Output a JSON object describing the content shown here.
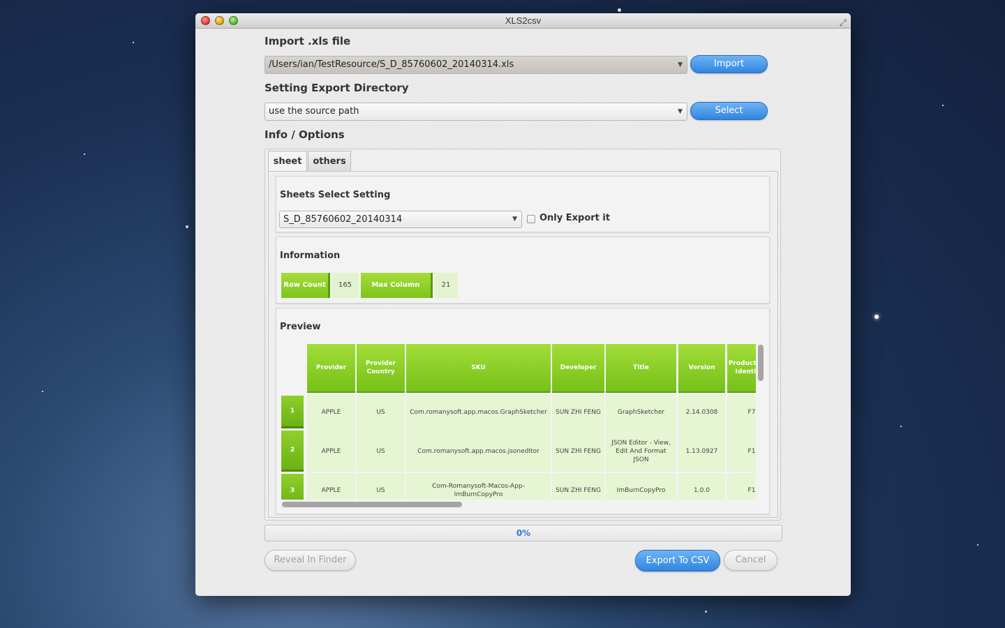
{
  "window": {
    "title": "XLS2csv"
  },
  "import_section": {
    "label": "Import .xls file",
    "file_path": "/Users/ian/TestResource/S_D_85760602_20140314.xls",
    "import_button": "Import"
  },
  "export_section": {
    "label": "Setting Export Directory",
    "directory": "use the source path",
    "select_button": "Select"
  },
  "info_section": {
    "label": "Info / Options",
    "tabs": [
      {
        "label": "sheet"
      },
      {
        "label": "others"
      }
    ]
  },
  "sheets_panel": {
    "title": "Sheets Select Setting",
    "selected_sheet": "S_D_85760602_20140314",
    "only_export_label": "Only Export it"
  },
  "information_panel": {
    "title": "Information",
    "row_count_label": "Row Count",
    "row_count_value": "165",
    "max_col_label": "Max Column Count",
    "max_col_value": "21"
  },
  "preview_panel": {
    "title": "Preview",
    "headers": [
      "Provider",
      "Provider Country",
      "SKU",
      "Developer",
      "Title",
      "Version",
      "Product Type Identifier"
    ],
    "rows": [
      {
        "num": "1",
        "cells": [
          "APPLE",
          "US",
          "Com.romanysoft.app.macos.GraphSketcher",
          "SUN ZHI FENG",
          "GraphSketcher",
          "2.14.0308",
          "F7"
        ]
      },
      {
        "num": "2",
        "cells": [
          "APPLE",
          "US",
          "Com.romanysoft.app.macos.jsonedItor",
          "SUN ZHI FENG",
          "JSON Editor - View, Edit And Format JSON",
          "1.13.0927",
          "F1"
        ]
      },
      {
        "num": "3",
        "cells": [
          "APPLE",
          "US",
          "Com-Romanysoft-Macos-App-ImBurnCopyPro",
          "SUN ZHI FENG",
          "ImBurnCopyPro",
          "1.0.0",
          "F1"
        ]
      }
    ]
  },
  "progress": {
    "text": "0%"
  },
  "footer": {
    "reveal_button": "Reveal In Finder",
    "export_button": "Export To CSV",
    "cancel_button": "Cancel"
  },
  "colors": {
    "accent_green": "#8ccf26",
    "button_blue": "#2f86e0",
    "progress_text": "#3a78c8"
  }
}
